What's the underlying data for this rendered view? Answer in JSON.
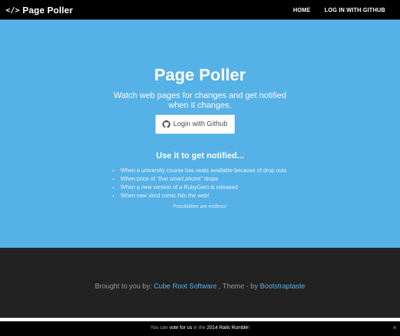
{
  "navbar": {
    "brand_icon": "</>",
    "brand_label": "Page Poller",
    "links": [
      "HOME",
      "LOG IN WITH GITHUB"
    ]
  },
  "hero": {
    "title": "Page Poller",
    "tagline": "Watch web pages for changes and get notified when it changes.",
    "login_button": "Login with Github",
    "notify_title": "Use it to get notified...",
    "use_cases": {
      "item1": "When a university course has seats available because of drop outs",
      "item2_before": "When price of ",
      "item2_em": "\"that smart phone\"",
      "item2_after": " drops",
      "item3": "When a new version of a RubyGem is released",
      "item4": "When new xkcd comic hits the web!"
    },
    "endless": "Possibilities are endless!"
  },
  "footer": {
    "prefix": "Brought to you by: ",
    "company_link": "Cube Root Software",
    "middle": " , Theme - by ",
    "theme_link": "Bootstraptaste"
  },
  "rumble": {
    "t1": "You can ",
    "t2": "vote for us",
    "t3": " in the ",
    "t4": "2014 Rails Rumble",
    "t5": "!",
    "close": "×"
  },
  "colors": {
    "hero_bg": "#56b1e6",
    "navbar_bg": "#000000",
    "footer_bg": "#222222",
    "link": "#58b1e6"
  },
  "icons": {
    "brand": "code-icon",
    "login": "github-icon",
    "close": "close-icon"
  }
}
